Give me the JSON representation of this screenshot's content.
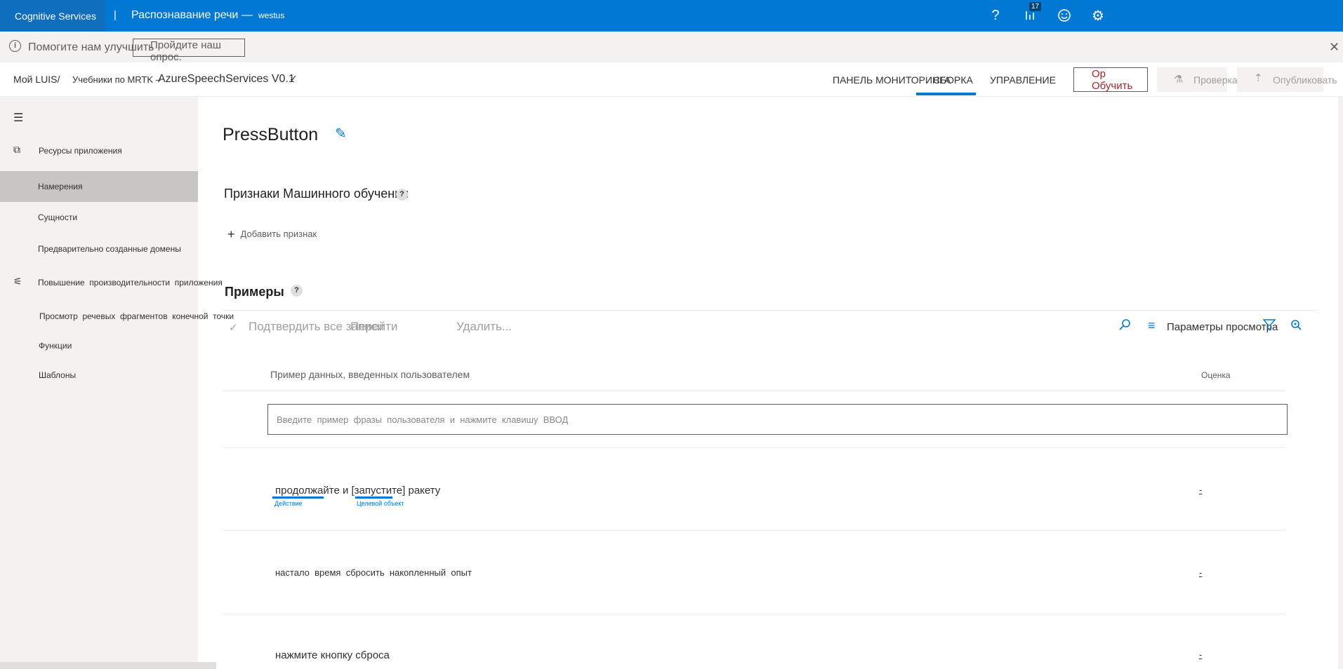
{
  "topbar": {
    "brand": "Cognitive Services",
    "separator": "|",
    "app_title": "Распознавание речи —",
    "region": "westus",
    "notification_count": "17",
    "icons": [
      "help-icon",
      "notifications-icon",
      "feedback-icon",
      "settings-icon"
    ]
  },
  "survey": {
    "text": "Помогите нам улучшить",
    "button_label": "Пройдите наш опрос."
  },
  "breadcrumb": {
    "root": "Мой LUIS/",
    "group": "Учебники по MRTK –",
    "app": "AzureSpeechServices V0.1"
  },
  "nav": {
    "dashboard": "ПАНЕЛЬ МОНИТОРИНГА",
    "build": "СБОРКА",
    "manage": "УПРАВЛЕНИЕ",
    "train": "Обучить",
    "train_prefix": "Op",
    "test": "Проверка",
    "publish": "Опубликовать"
  },
  "sidebar": {
    "items": [
      {
        "label": "Ресурсы приложения",
        "icon": "app-assets-icon"
      },
      {
        "label": "Намерения"
      },
      {
        "label": "Сущности"
      },
      {
        "label": "Предварительно созданные домены"
      },
      {
        "label": "Повышение  производительности  приложения",
        "icon": "sliders-icon"
      },
      {
        "label": "Просмотр  речевых  фрагментов  конечной  точки"
      },
      {
        "label": "Функции"
      },
      {
        "label": "Шаблоны"
      }
    ],
    "active_index": 1
  },
  "intent": {
    "name": "PressButton"
  },
  "features": {
    "heading": "Признаки Машинного обучения",
    "add_label": "Добавить признак"
  },
  "examples": {
    "heading": "Примеры",
    "confirm_all": "Подтвердить все записи",
    "goto": "Перейти",
    "delete": "Удалить...",
    "view_options": "Параметры просмотра",
    "col_user_input": "Пример данных, введенных пользователем",
    "col_score": "Оценка",
    "input_placeholder": "Введите  пример  фразы  пользователя  и  нажмите  клавишу  ВВОД",
    "rows": [
      {
        "text": "продолжайте и [запустите] ракету",
        "score": "-",
        "entities": [
          {
            "label": "Действие"
          },
          {
            "label": "Целевой объект"
          }
        ]
      },
      {
        "text": "настало  время  сбросить  накопленный  опыт",
        "score": "-"
      },
      {
        "text": "нажмите кнопку сброса",
        "score": "-"
      }
    ]
  },
  "colors": {
    "accent": "#0078d4",
    "brand_bg": "#106ebe",
    "sidebar_bg": "#f3f2f1",
    "sidebar_active": "#c8c6c4",
    "train_text": "#a4262c"
  }
}
